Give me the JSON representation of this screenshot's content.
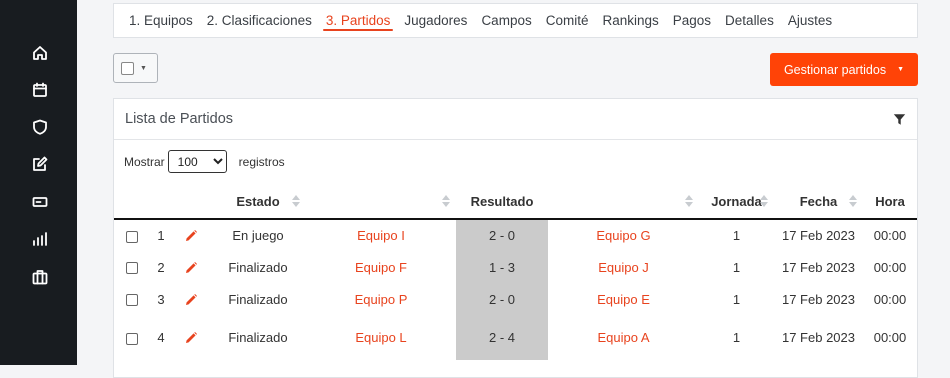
{
  "tabs": [
    {
      "label": "1. Equipos"
    },
    {
      "label": "2. Clasificaciones"
    },
    {
      "label": "3. Partidos"
    },
    {
      "label": "Jugadores"
    },
    {
      "label": "Campos"
    },
    {
      "label": "Comité"
    },
    {
      "label": "Rankings"
    },
    {
      "label": "Pagos"
    },
    {
      "label": "Detalles"
    },
    {
      "label": "Ajustes"
    }
  ],
  "active_tab": "3. Partidos",
  "toolbar": {
    "manage_label": "Gestionar partidos"
  },
  "panel": {
    "title": "Lista de Partidos"
  },
  "length_menu": {
    "before": "Mostrar",
    "value": "100",
    "after": "registros"
  },
  "columns": {
    "estado": "Estado",
    "resultado": "Resultado",
    "jornada": "Jornada",
    "fecha": "Fecha",
    "hora": "Hora"
  },
  "rows": [
    {
      "num": "1",
      "estado": "En juego",
      "home": "Equipo I",
      "result": "2 - 0",
      "away": "Equipo G",
      "jornada": "1",
      "fecha": "17 Feb 2023",
      "hora": "00:00"
    },
    {
      "num": "2",
      "estado": "Finalizado",
      "home": "Equipo F",
      "result": "1 - 3",
      "away": "Equipo J",
      "jornada": "1",
      "fecha": "17 Feb 2023",
      "hora": "00:00"
    },
    {
      "num": "3",
      "estado": "Finalizado",
      "home": "Equipo P",
      "result": "2 - 0",
      "away": "Equipo E",
      "jornada": "1",
      "fecha": "17 Feb 2023",
      "hora": "00:00"
    },
    {
      "num": "4",
      "estado": "Finalizado",
      "home": "Equipo L",
      "result": "2 - 4",
      "away": "Equipo A",
      "jornada": "1",
      "fecha": "17 Feb 2023",
      "hora": "00:00"
    }
  ],
  "sidebar": {
    "icons": [
      "home-icon",
      "calendar-icon",
      "shield-icon",
      "edit-icon",
      "ticket-icon",
      "bar-chart-icon",
      "briefcase-icon"
    ]
  },
  "colors": {
    "accent": "#e8431e",
    "button": "#ff4307",
    "sidebar": "#181c20",
    "result_bg": "#cbcbcb"
  }
}
